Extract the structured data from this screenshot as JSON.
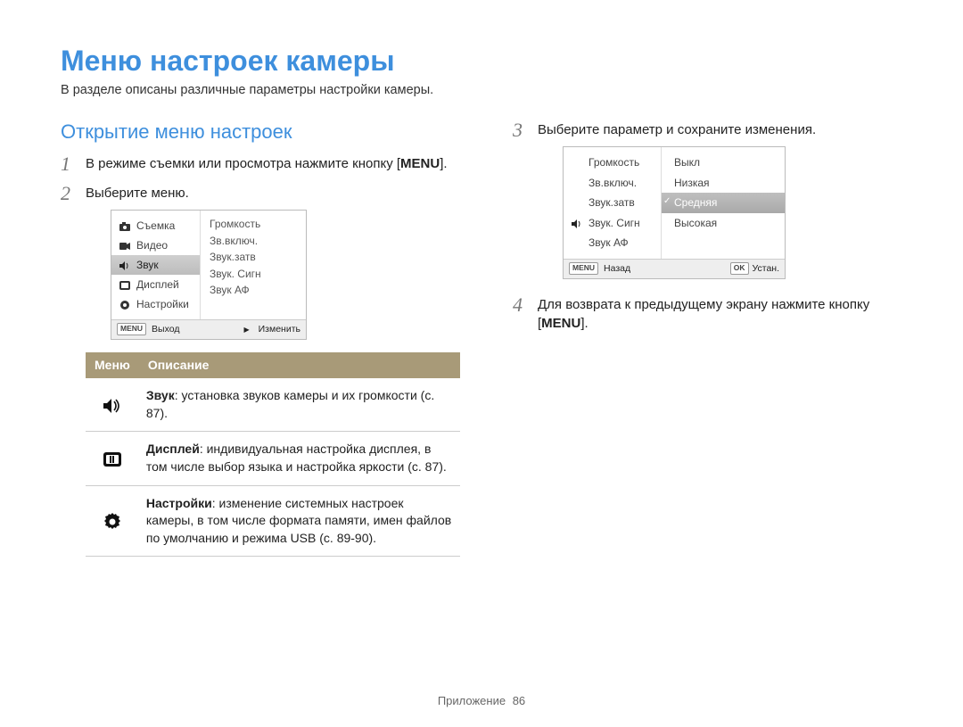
{
  "title": "Меню настроек камеры",
  "intro": "В разделе описаны различные параметры настройки камеры.",
  "section_title": "Открытие меню настроек",
  "menu_token": "MENU",
  "steps": {
    "s1_a": "В режиме съемки или просмотра нажмите кнопку ",
    "s1_b": "[",
    "s1_c": "].",
    "s2": "Выберите меню.",
    "s3": "Выберите параметр и сохраните изменения.",
    "s4_a": "Для возврата к предыдущему экрану нажмите кнопку ",
    "s4_b": "[",
    "s4_c": "]."
  },
  "panel1": {
    "left": [
      "Съемка",
      "Видео",
      "Звук",
      "Дисплей",
      "Настройки"
    ],
    "selected_index": 2,
    "right": [
      "Громкость",
      "Зв.включ.",
      "Звук.затв",
      "Звук. Сигн",
      "Звук АФ"
    ],
    "foot_left_badge": "MENU",
    "foot_left": "Выход",
    "foot_right": "Изменить"
  },
  "panel2": {
    "left": [
      "Громкость",
      "Зв.включ.",
      "Звук.затв",
      "Звук. Сигн",
      "Звук АФ"
    ],
    "speaker_row_index": 3,
    "right": [
      "Выкл",
      "Низкая",
      "Средняя",
      "Высокая"
    ],
    "selected_index": 2,
    "foot_left_badge": "MENU",
    "foot_left": "Назад",
    "foot_right_badge": "OK",
    "foot_right": "Устан."
  },
  "table": {
    "head_menu": "Меню",
    "head_desc": "Описание",
    "rows": [
      {
        "icon": "speaker",
        "bold": "Звук",
        "text": ": установка звуков камеры и их громкости (с. 87)."
      },
      {
        "icon": "display",
        "bold": "Дисплей",
        "text": ": индивидуальная настройка дисплея, в том числе выбор языка и настройка яркости (с. 87)."
      },
      {
        "icon": "gear",
        "bold": "Настройки",
        "text": ": изменение системных настроек камеры, в том числе формата памяти, имен файлов по умолчанию и режима USB (с. 89-90)."
      }
    ]
  },
  "footer": {
    "label": "Приложение",
    "page": "86"
  }
}
